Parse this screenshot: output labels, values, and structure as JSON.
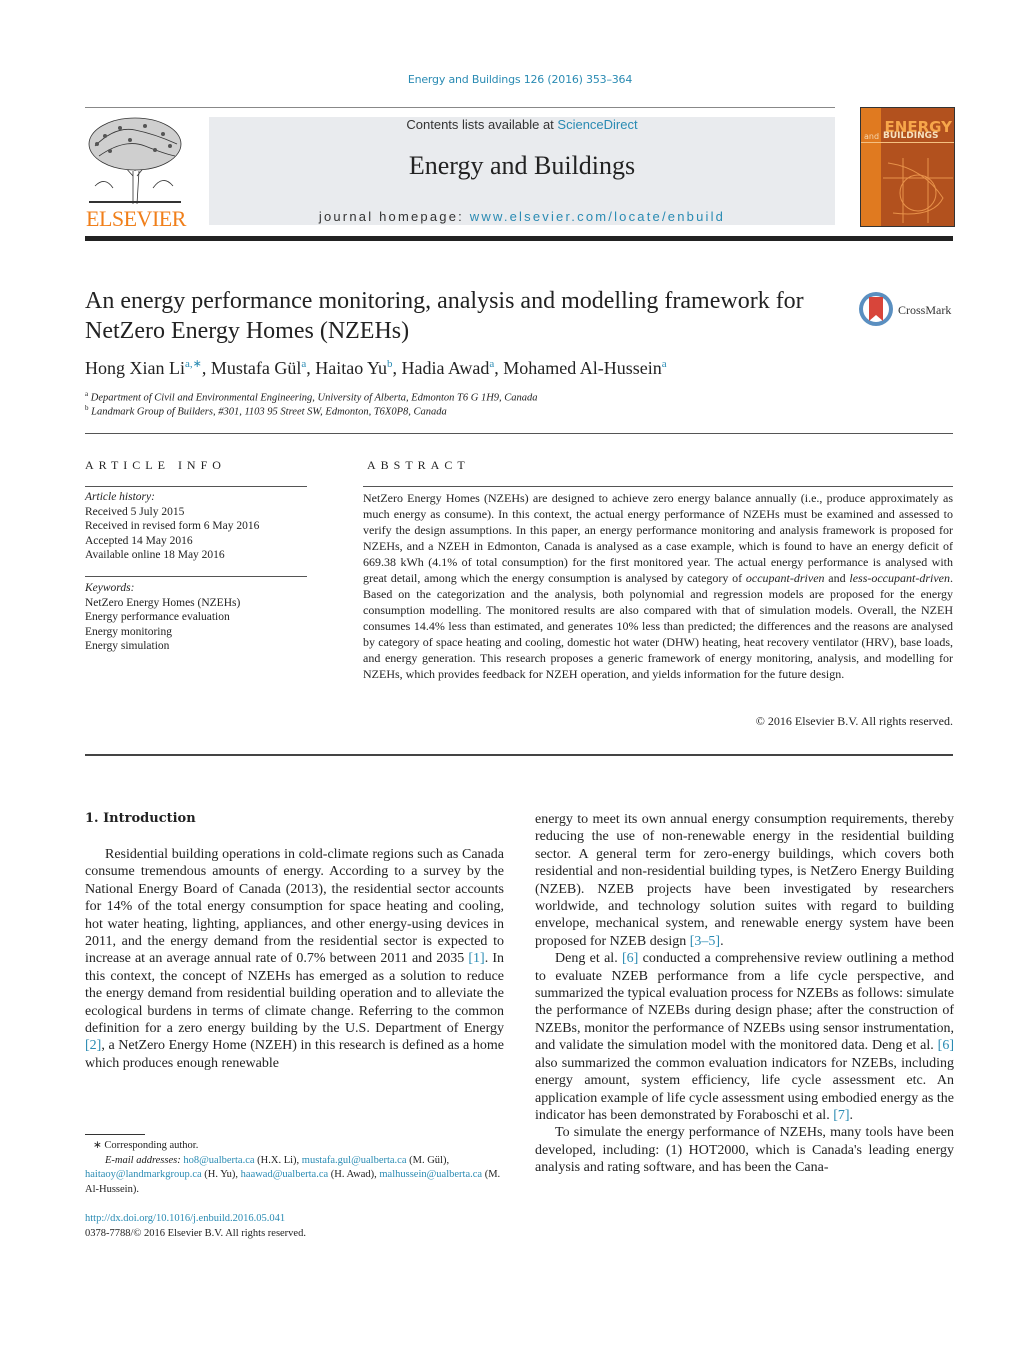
{
  "header": {
    "journal_reference": "Energy and Buildings 126 (2016) 353–364",
    "contents_prefix": "Contents lists available at ",
    "contents_link": "ScienceDirect",
    "journal_title": "Energy and Buildings",
    "homepage_prefix": "journal homepage: ",
    "homepage_link": "www.elsevier.com/locate/enbuild",
    "publisher_logo": "ELSEVIER",
    "cover": {
      "title_line1": "ENERGY",
      "title_and": "and",
      "title_line2": "BUILDINGS"
    },
    "crossmark_label": "CrossMark"
  },
  "article": {
    "title": "An energy performance monitoring, analysis and modelling framework for NetZero Energy Homes (NZEHs)",
    "authors": [
      {
        "name": "Hong Xian Li",
        "sup": "a,∗"
      },
      {
        "name": "Mustafa Gül",
        "sup": "a"
      },
      {
        "name": "Haitao Yu",
        "sup": "b"
      },
      {
        "name": "Hadia Awad",
        "sup": "a"
      },
      {
        "name": "Mohamed Al-Hussein",
        "sup": "a"
      }
    ],
    "affiliations": [
      {
        "mark": "a",
        "text": "Department of Civil and Environmental Engineering, University of Alberta, Edmonton T6 G 1H9, Canada"
      },
      {
        "mark": "b",
        "text": "Landmark Group of Builders, #301, 1103 95 Street SW, Edmonton, T6X0P8, Canada"
      }
    ]
  },
  "article_info": {
    "heading": "ARTICLE INFO",
    "history_label": "Article history:",
    "history": [
      "Received 5 July 2015",
      "Received in revised form 6 May 2016",
      "Accepted 14 May 2016",
      "Available online 18 May 2016"
    ],
    "keywords_label": "Keywords:",
    "keywords": [
      "NetZero Energy Homes (NZEHs)",
      "Energy performance evaluation",
      "Energy monitoring",
      "Energy simulation"
    ]
  },
  "abstract": {
    "heading": "ABSTRACT",
    "part1": "NetZero Energy Homes (NZEHs) are designed to achieve zero energy balance annually (i.e., produce approximately as much energy as consume). In this context, the actual energy performance of NZEHs must be examined and assessed to verify the design assumptions. In this paper, an energy performance monitoring and analysis framework is proposed for NZEHs, and a NZEH in Edmonton, Canada is analysed as a case example, which is found to have an energy deficit of 669.38 kWh (4.1% of total consumption) for the first monitored year. The actual energy performance is analysed with great detail, among which the energy consumption is analysed by category of ",
    "italic1": "occupant-driven",
    "part2": " and ",
    "italic2": "less-occupant-driven",
    "part3": ". Based on the categorization and the analysis, both polynomial and regression models are proposed for the energy consumption modelling. The monitored results are also compared with that of simulation models. Overall, the NZEH consumes 14.4% less than estimated, and generates 10% less than predicted; the differences and the reasons are analysed by category of space heating and cooling, domestic hot water (DHW) heating, heat recovery ventilator (HRV), base loads, and energy generation. This research proposes a generic framework of energy monitoring, analysis, and modelling for NZEHs, which provides feedback for NZEH operation, and yields information for the future design.",
    "copyright": "© 2016 Elsevier B.V. All rights reserved."
  },
  "introduction": {
    "heading": "1.  Introduction",
    "left_p1_a": "Residential building operations in cold-climate regions such as Canada consume tremendous amounts of energy. According to a survey by the National Energy Board of Canada (2013), the residential sector accounts for 14% of the total energy consumption for space heating and cooling, hot water heating, lighting, appliances, and other energy-using devices in 2011, and the energy demand from the residential sector is expected to increase at an average annual rate of 0.7% between 2011 and 2035 ",
    "ref1": "[1]",
    "left_p1_b": ". In this context, the concept of NZEHs has emerged as a solution to reduce the energy demand from residential building operation and to alleviate the ecological burdens in terms of climate change. Referring to the common definition for a zero energy building by the U.S. Department of Energy ",
    "ref2": "[2]",
    "left_p1_c": ", a NetZero Energy Home (NZEH) in this research is defined as a home which produces enough renewable",
    "right_p1_a": "energy to meet its own annual energy consumption requirements, thereby reducing the use of non-renewable energy in the residential building sector. A general term for zero-energy buildings, which covers both residential and non-residential building types, is NetZero Energy Building (NZEB). NZEB projects have been investigated by researchers worldwide, and technology solution suites with regard to building envelope, mechanical system, and renewable energy system have been proposed for NZEB design ",
    "ref3": "[3–5]",
    "right_p1_b": ".",
    "right_p2_a": "Deng et al. ",
    "ref6a": "[6]",
    "right_p2_b": " conducted a comprehensive review outlining a method to evaluate NZEB performance from a life cycle perspective, and summarized the typical evaluation process for NZEBs as follows: simulate the performance of NZEBs during design phase; after the construction of NZEBs, monitor the performance of NZEBs using sensor instrumentation, and validate the simulation model with the monitored data. Deng et al. ",
    "ref6b": "[6]",
    "right_p2_c": " also summarized the common evaluation indicators for NZEBs, including energy amount, system efficiency, life cycle assessment etc. An application example of life cycle assessment using embodied energy as the indicator has been demonstrated by Foraboschi et al. ",
    "ref7": "[7]",
    "right_p2_d": ".",
    "right_p3": "To simulate the energy performance of NZEHs, many tools have been developed, including: (1) HOT2000, which is Canada's leading energy analysis and rating software, and has been the Cana-"
  },
  "footnotes": {
    "corresponding": "∗  Corresponding author.",
    "email_label": "E-mail addresses: ",
    "emails": [
      {
        "email": "ho8@ualberta.ca",
        "who": " (H.X. Li), "
      },
      {
        "email": "mustafa.gul@ualberta.ca",
        "who": " (M. Gül), "
      },
      {
        "email": "haitaoy@landmarkgroup.ca",
        "who": " (H. Yu), "
      },
      {
        "email": "haawad@ualberta.ca",
        "who": " (H. Awad), "
      },
      {
        "email": "malhussein@ualberta.ca",
        "who": " (M. Al-Hussein)."
      }
    ],
    "doi": "http://dx.doi.org/10.1016/j.enbuild.2016.05.041",
    "issn": "0378-7788/© 2016 Elsevier B.V. All rights reserved."
  },
  "colors": {
    "link": "#2a8bb3",
    "elsevier_orange": "#f07f1a",
    "banner_bg": "#e9ebee",
    "cover_bg": "#b2511e"
  }
}
